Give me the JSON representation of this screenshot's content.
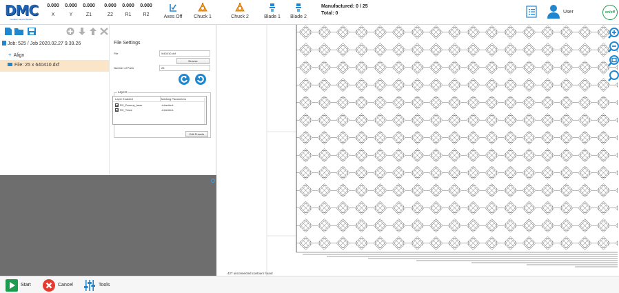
{
  "logo": {
    "text": "DMC",
    "tagline": "Inovation beyond borders"
  },
  "axes": [
    {
      "value": "0.000",
      "label": "X"
    },
    {
      "value": "0.000",
      "label": "Y"
    },
    {
      "value": "0.000",
      "label": "Z1"
    },
    {
      "value": "0.000",
      "label": "Z2"
    },
    {
      "value": "0.000",
      "label": "R1"
    },
    {
      "value": "0.000",
      "label": "R2"
    }
  ],
  "tools": {
    "axes_off": "Axes Off",
    "chuck1": "Chuck 1",
    "chuck2": "Chuck 2",
    "blade1": "Blade 1",
    "blade2": "Blade 2"
  },
  "counts": {
    "manufactured": "Manufactured:  0 / 25",
    "total": "Total:  0"
  },
  "header_right": {
    "user": "User",
    "power": "on/off"
  },
  "left": {
    "job": "Job: 525 / Job 2020.02.27 9.39.26",
    "align": "Align",
    "file": "File: 25 x 640410.dxf"
  },
  "settings": {
    "title": "File Settings",
    "file_label": "File",
    "file_value": "\\640410.dxf",
    "browse": "Browse",
    "parts_label": "Number of Parts",
    "parts_value": "25",
    "layers_legend": "Layers",
    "layer_col": "Layer Enabled",
    "marking_col": "Marking Parameters",
    "layers": [
      {
        "name": "RX_Dummy_laser",
        "param": "-inherited-"
      },
      {
        "name": "RX_Trace",
        "param": "-inherited-"
      }
    ],
    "edit_presets": "Edit Presets"
  },
  "status": "427 unconnected contours found",
  "bottom": {
    "start": "Start",
    "cancel": "Cancel",
    "tools": "Tools"
  },
  "colors": {
    "accent": "#1e87d0",
    "selected_row": "#fbe5c8",
    "start": "#1d9b4f",
    "cancel": "#e63b2e",
    "chuck": "#f28c1b"
  },
  "icons": [
    "new-file-icon",
    "open-folder-icon",
    "save-icon",
    "add-icon",
    "move-down-icon",
    "move-up-icon",
    "delete-icon",
    "axes-off-icon",
    "chuck-icon",
    "blade-icon",
    "list-icon",
    "user-icon",
    "power-icon",
    "zoom-in-icon",
    "zoom-out-icon",
    "zoom-fit-icon",
    "zoom-search-icon",
    "play-icon",
    "cancel-icon",
    "sliders-icon",
    "rotate-left-icon",
    "rotate-right-icon"
  ]
}
